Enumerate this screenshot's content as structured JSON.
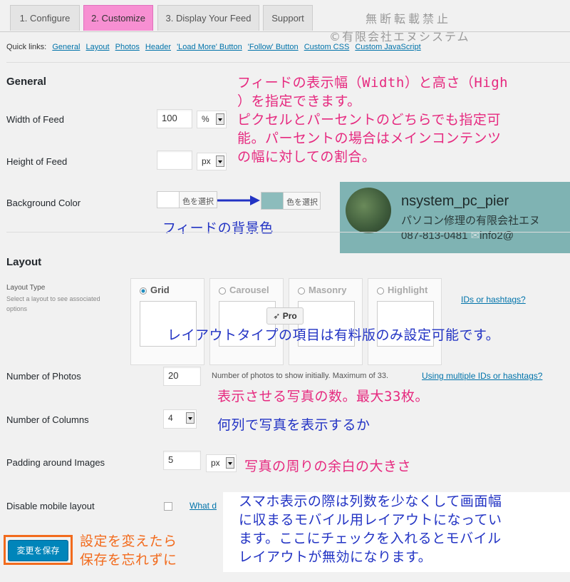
{
  "tabs": [
    {
      "label": "1. Configure"
    },
    {
      "label": "2. Customize"
    },
    {
      "label": "3. Display Your Feed"
    },
    {
      "label": "Support"
    }
  ],
  "watermark": {
    "line1": "無断転載禁止",
    "line2": "©有限会社エヌシステム"
  },
  "quick_links": {
    "label": "Quick links:",
    "items": [
      "General",
      "Layout",
      "Photos",
      "Header",
      "'Load More' Button",
      "'Follow' Button",
      "Custom CSS",
      "Custom JavaScript"
    ]
  },
  "general": {
    "heading": "General",
    "width": {
      "label": "Width of Feed",
      "value": "100",
      "unit": "%"
    },
    "height": {
      "label": "Height of Feed",
      "value": "",
      "unit": "px"
    },
    "background": {
      "label": "Background Color",
      "button": "色を選択",
      "button2": "色を選択",
      "swatch_before": "#ffffff",
      "swatch_after": "#8cbcbc"
    }
  },
  "annotations": {
    "general_1": "フィードの表示幅（Width）と高さ（High",
    "general_2": "）を指定できます。",
    "general_3": "ピクセルとパーセントのどちらでも指定可",
    "general_4": "能。パーセントの場合はメインコンテンツ",
    "general_5": "の幅に対しての割合。",
    "bg": "フィードの背景色",
    "layout": "レイアウトタイプの項目は有料版のみ設定可能です。",
    "photos": "表示させる写真の数。最大33枚。",
    "columns": "何列で写真を表示するか",
    "padding": "写真の周りの余白の大きさ",
    "mobile_1": "スマホ表示の際は列数を少なくして画面幅",
    "mobile_2": "に収まるモバイル用レイアウトになってい",
    "mobile_3": "ます。ここにチェックを入れるとモバイル",
    "mobile_4": "レイアウトが無効になります。",
    "save_1": "設定を変えたら",
    "save_2": "保存を忘れずに"
  },
  "profile": {
    "name": "nsystem_pc_pier",
    "company": "パソコン修理の有限会社エヌ",
    "phone": "087-813-0481",
    "mail": "info2@",
    "bg": "#8cbcbc"
  },
  "layout": {
    "heading": "Layout",
    "type_label": "Layout Type",
    "type_help": "Select a layout to see associated options",
    "options": [
      "Grid",
      "Carousel",
      "Masonry",
      "Highlight"
    ],
    "pro_badge": "Pro",
    "ids_link": "IDs or hashtags?"
  },
  "photos": {
    "label": "Number of Photos",
    "value": "20",
    "help": "Number of photos to show initially. Maximum of 33.",
    "link": "Using multiple IDs or hashtags?"
  },
  "columns": {
    "label": "Number of Columns",
    "value": "4"
  },
  "padding": {
    "label": "Padding around Images",
    "value": "5",
    "unit": "px"
  },
  "mobile": {
    "label": "Disable mobile layout",
    "link": "What d"
  },
  "save_button": "変更を保存",
  "colors": {
    "accent": "#0073aa",
    "tab_active": "#f78fd2",
    "pink": "#e6297f",
    "annotation_blue": "#2233c4",
    "orange": "#f26b1d"
  }
}
